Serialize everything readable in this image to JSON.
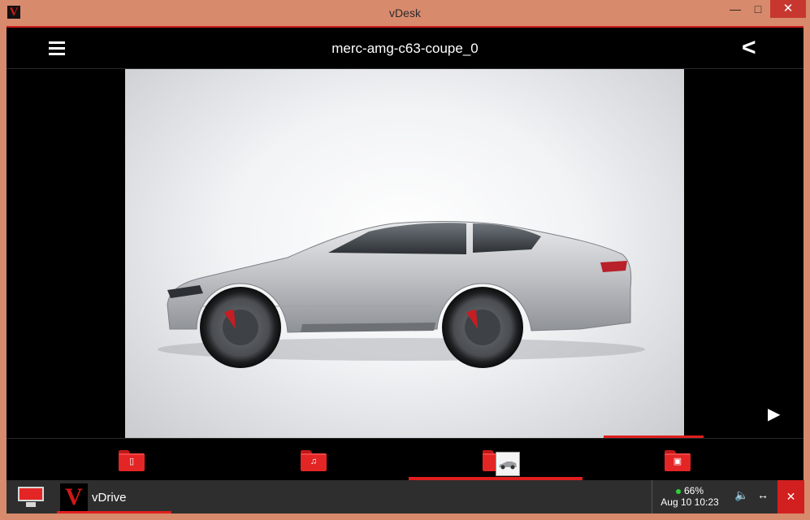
{
  "window": {
    "title": "vDesk",
    "logo": "V",
    "minimize": "—",
    "maximize": "□",
    "close": "✕"
  },
  "header": {
    "title": "merc-amg-c63-coupe_0",
    "menu_icon": "hamburger-icon",
    "back_icon": "<"
  },
  "viewer": {
    "next_icon": "▶"
  },
  "tabs": [
    {
      "name": "documents",
      "glyph": "▯",
      "icon": "document-icon"
    },
    {
      "name": "music",
      "glyph": "♫",
      "icon": "music-icon"
    },
    {
      "name": "pictures",
      "glyph": "",
      "icon": "picture-icon",
      "active": true
    },
    {
      "name": "video",
      "glyph": "▣",
      "icon": "video-icon"
    }
  ],
  "taskbar": {
    "app_logo": "V",
    "app_name": "vDrive",
    "battery": "66%",
    "datetime": "Aug 10 10:23",
    "volume_icon": "🔈",
    "resize_icon": "↔",
    "close_icon": "✕"
  },
  "colors": {
    "accent": "#e01e1e",
    "frame": "#d88a6c",
    "background": "#000000"
  }
}
